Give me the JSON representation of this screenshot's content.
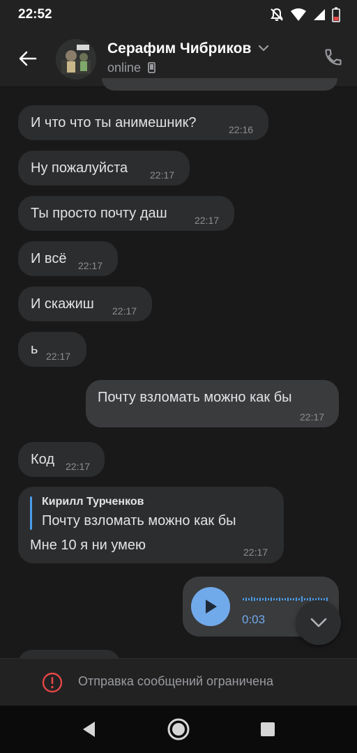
{
  "status_bar": {
    "time": "22:52"
  },
  "header": {
    "contact_name": "Серафим Чибриков",
    "status": "online"
  },
  "messages": [
    {
      "text": "И что что ты анимешник?",
      "time": "22:16"
    },
    {
      "text": "Ну пожалуйста",
      "time": "22:17"
    },
    {
      "text": "Ты просто почту даш",
      "time": "22:17"
    },
    {
      "text": "И всё",
      "time": "22:17"
    },
    {
      "text": "И скажиш",
      "time": "22:17"
    },
    {
      "text": "ь",
      "time": "22:17"
    },
    {
      "text": "Почту взломать можно как бы",
      "time": "22:17"
    },
    {
      "text": "Код",
      "time": "22:17"
    },
    {
      "reply_author": "Кирилл Турченков",
      "reply_text": "Почту взломать можно как бы",
      "text": "Мне 10 я ни умею",
      "time": "22:17"
    }
  ],
  "voice_message": {
    "duration": "0:03"
  },
  "footer": {
    "restriction_text": "Отправка сообщений ограничена"
  },
  "colors": {
    "background": "#19191a",
    "bubble_in": "#2c2d2e",
    "bubble_out": "#3a3b3d",
    "accent": "#4a9de8",
    "warning": "#e64646"
  },
  "icons": [
    "back-arrow-icon",
    "chevron-down-icon",
    "phone-icon",
    "mobile-device-icon",
    "play-icon",
    "error-icon",
    "nav-back-icon",
    "nav-home-icon",
    "nav-recents-icon"
  ]
}
